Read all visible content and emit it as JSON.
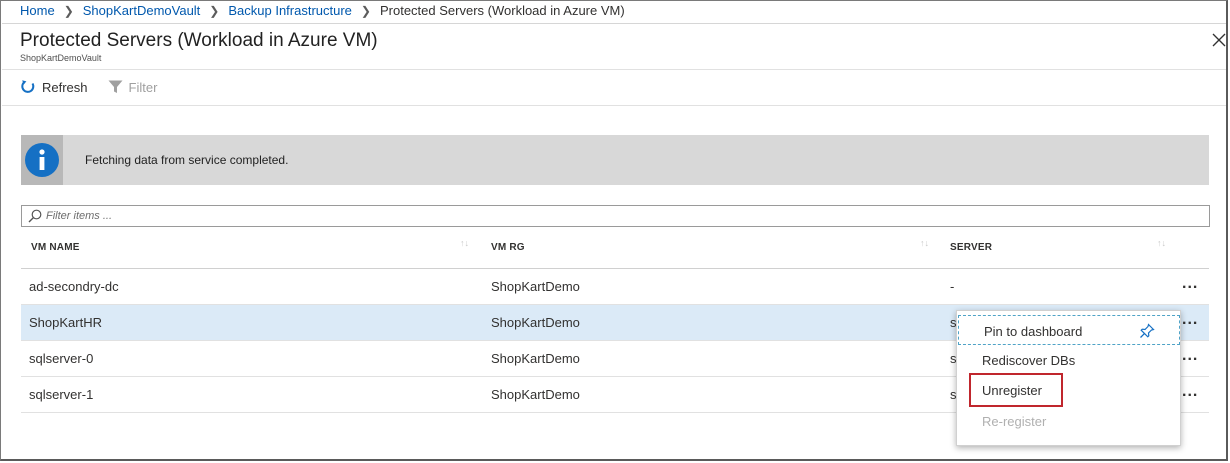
{
  "breadcrumb": {
    "items": [
      "Home",
      "ShopKartDemoVault",
      "Backup Infrastructure"
    ],
    "current": "Protected Servers (Workload in Azure VM)"
  },
  "blade": {
    "title": "Protected Servers (Workload in Azure VM)",
    "subtitle": "ShopKartDemoVault"
  },
  "toolbar": {
    "refresh_label": "Refresh",
    "filter_label": "Filter"
  },
  "banner": {
    "message": "Fetching data from service completed."
  },
  "search": {
    "placeholder": "Filter items ..."
  },
  "table": {
    "columns": [
      "VM NAME",
      "VM RG",
      "SERVER"
    ],
    "sort_glyph": "↑↓",
    "rows": [
      {
        "vm_name": "ad-secondry-dc",
        "vm_rg": "ShopKartDemo",
        "server": "-"
      },
      {
        "vm_name": "ShopKartHR",
        "vm_rg": "ShopKartDemo",
        "server": "s"
      },
      {
        "vm_name": "sqlserver-0",
        "vm_rg": "ShopKartDemo",
        "server": "s"
      },
      {
        "vm_name": "sqlserver-1",
        "vm_rg": "ShopKartDemo",
        "server": "s"
      }
    ],
    "more_glyph": "...",
    "selected_row": 1
  },
  "context_menu": {
    "items": [
      "Pin to dashboard",
      "Rediscover DBs",
      "Unregister",
      "Re-register"
    ],
    "highlighted_item": "Unregister",
    "disabled_item": "Re-register"
  },
  "colors": {
    "link": "#0058ad",
    "selected_row": "#dbeaf7",
    "info_icon": "#1570c4",
    "highlight_border": "#c0262d",
    "banner_bg": "#d8d8d8"
  },
  "icons": {
    "close": "close-icon",
    "refresh": "refresh-icon",
    "filter": "filter-icon",
    "info": "info-icon",
    "search": "search-icon",
    "pin": "pin-icon"
  }
}
